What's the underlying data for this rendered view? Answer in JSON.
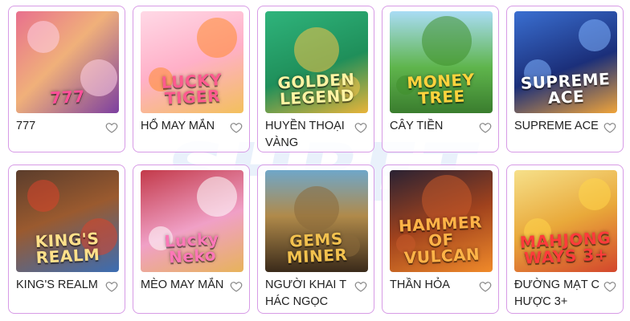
{
  "games": [
    {
      "name": "777",
      "art_title": "777",
      "bg": "linear-gradient(135deg,#e8708e 0%,#f0b07a 45%,#7c3fa0 100%)",
      "title_color": "#ff4f9a",
      "deco": "#ffd1e6"
    },
    {
      "name": "HỔ MAY MẮN",
      "art_title": "LUCKY TIGER",
      "bg": "linear-gradient(160deg,#ffd9e6 0%,#ffb0c8 50%,#f3c05c 100%)",
      "title_color": "#ff5a8f",
      "deco": "#ff8b2e"
    },
    {
      "name": "HUYỀN THOẠI VÀNG",
      "art_title": "GOLDEN LEGEND",
      "bg": "linear-gradient(160deg,#2fb47c 0%,#1f8f5a 55%,#e9b43a 100%)",
      "title_color": "#fff4a3",
      "deco": "#f6c44a"
    },
    {
      "name": "CÂY TIỀN",
      "art_title": "MONEY TREE",
      "bg": "linear-gradient(180deg,#a9dcf5 0%,#5fb54c 55%,#3a7d2e 100%)",
      "title_color": "#ffd33d",
      "deco": "#3f8f2c"
    },
    {
      "name": "SUPREME ACE",
      "art_title": "SUPREME ACE",
      "bg": "linear-gradient(160deg,#3a6fd1 0%,#1b2f7a 55%,#f0a43a 100%)",
      "title_color": "#ffffff",
      "deco": "#7fb3ff"
    },
    {
      "name": "KING'S REALM",
      "art_title": "KING'S REALM",
      "bg": "linear-gradient(160deg,#5b3d2c 0%,#9a5a2f 45%,#3b6db3 100%)",
      "title_color": "#ffe08a",
      "deco": "#d9442c"
    },
    {
      "name": "MÈO MAY MẮN",
      "art_title": "Lucky Neko",
      "bg": "linear-gradient(160deg,#c33a4a 0%,#f0a0c6 55%,#e7b35a 100%)",
      "title_color": "#ff77b8",
      "deco": "#ffffff"
    },
    {
      "name": "NGƯỜI KHAI THÁC NGỌC",
      "art_title": "GEMS MINER",
      "bg": "linear-gradient(180deg,#6fa7c9 0%,#b08a4a 45%,#3a2a1a 100%)",
      "title_color": "#f2c14e",
      "deco": "#8a6a3a"
    },
    {
      "name": "THẦN HỎA",
      "art_title": "HAMMER OF VULCAN",
      "bg": "linear-gradient(160deg,#2a2233 0%,#a0421d 50%,#f08a2a 100%)",
      "title_color": "#ffb347",
      "deco": "#c75a2a"
    },
    {
      "name": "ĐƯỜNG MẠT CHƯỢC 3+",
      "art_title": "MAHJONG WAYS 3+",
      "bg": "linear-gradient(160deg,#f6e08a 0%,#e9a93a 50%,#d3462c 100%)",
      "title_color": "#ff3b3b",
      "deco": "#ffd54a"
    }
  ]
}
